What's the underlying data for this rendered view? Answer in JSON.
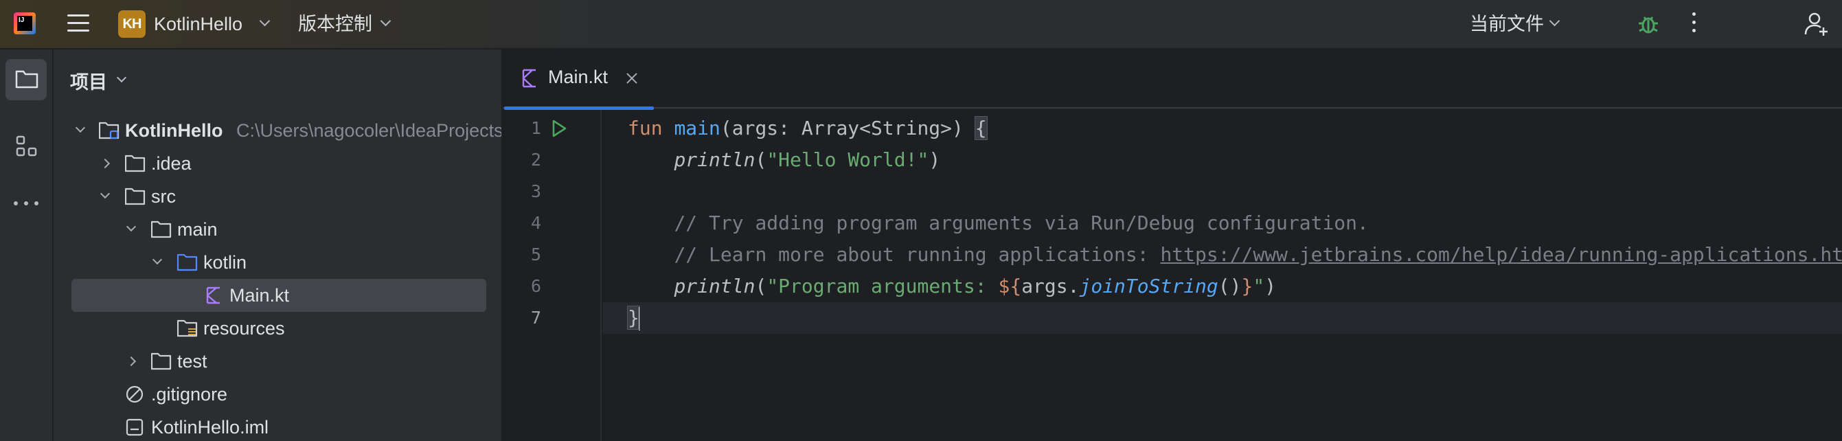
{
  "topbar": {
    "app_logo_text": "IJ",
    "project_badge": "KH",
    "project_name": "KotlinHello",
    "vcs_label": "版本控制",
    "run_config_label": "当前文件",
    "icons": [
      "menu-icon",
      "run-icon",
      "debug-icon",
      "more-vertical-icon",
      "add-user-icon"
    ],
    "colors": {
      "run": "#4aa65f",
      "badge": "#b57f1c",
      "accent": "#3574f0"
    }
  },
  "toolstrip": {
    "items": [
      {
        "icon": "folder-icon",
        "active": true
      },
      {
        "icon": "structure-icon",
        "active": false
      },
      {
        "icon": "more-horizontal-icon",
        "active": false
      }
    ]
  },
  "project_panel": {
    "title": "项目",
    "tree": [
      {
        "label": "KotlinHello",
        "path": "C:\\Users\\nagocoler\\IdeaProjects\\KotlinHello",
        "icon": "module-folder-icon",
        "expanded": true,
        "depth": 0
      },
      {
        "label": ".idea",
        "icon": "folder-icon",
        "expanded": false,
        "depth": 1
      },
      {
        "label": "src",
        "icon": "folder-icon",
        "expanded": true,
        "depth": 1
      },
      {
        "label": "main",
        "icon": "folder-icon",
        "expanded": true,
        "depth": 2
      },
      {
        "label": "kotlin",
        "icon": "source-folder-icon",
        "expanded": true,
        "depth": 3
      },
      {
        "label": "Main.kt",
        "icon": "kotlin-file-icon",
        "selected": true,
        "depth": 4
      },
      {
        "label": "resources",
        "icon": "resources-folder-icon",
        "depth": 3
      },
      {
        "label": "test",
        "icon": "folder-icon",
        "expanded": false,
        "depth": 2
      },
      {
        "label": ".gitignore",
        "icon": "ignore-file-icon",
        "depth": 1
      },
      {
        "label": "KotlinHello.iml",
        "icon": "iml-file-icon",
        "depth": 1
      }
    ]
  },
  "editor": {
    "tab": {
      "label": "Main.kt",
      "icon": "kotlin-file-icon"
    },
    "line_numbers": [
      "1",
      "2",
      "3",
      "4",
      "5",
      "6",
      "7"
    ],
    "current_line": 7,
    "code": {
      "l1_kw": "fun",
      "l1_fn": "main",
      "l1_rest": "(args: Array<String>) ",
      "l1_brace": "{",
      "l2_fn": "println",
      "l2_str": "\"Hello World!\"",
      "l4_comment": "// Try adding program arguments via Run/Debug configuration.",
      "l5_comment": "// Learn more about running applications: ",
      "l5_url": "https://www.jetbrains.com/help/idea/running-applications.html",
      "l6_fn": "println",
      "l6_str1": "\"Program arguments: ",
      "l6_tmpl_open": "${",
      "l6_args": "args.",
      "l6_call": "joinToString",
      "l6_parens": "()",
      "l6_tmpl_close": "}",
      "l6_str2": "\"",
      "l7_brace": "}"
    }
  }
}
